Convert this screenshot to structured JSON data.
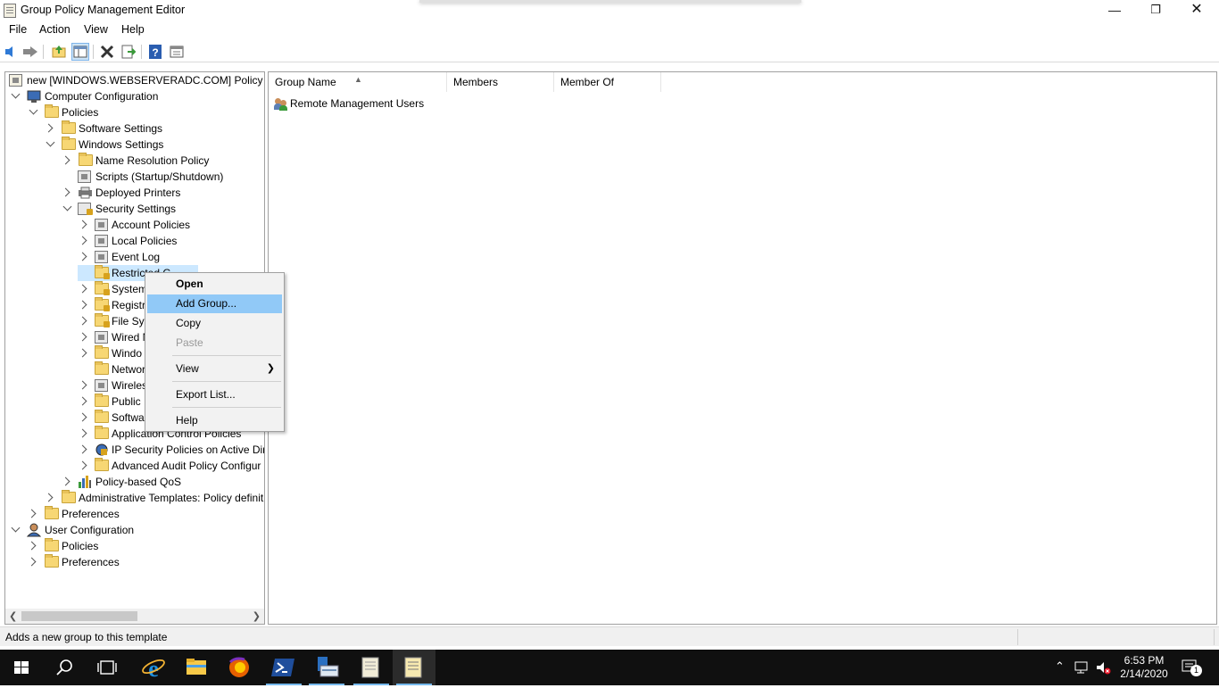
{
  "window": {
    "title": "Group Policy Management Editor"
  },
  "menu": {
    "file": "File",
    "action": "Action",
    "view": "View",
    "help": "Help"
  },
  "toolbar": {
    "buttons": [
      "back-icon",
      "forward-icon",
      "up-folder-icon",
      "show-hide-tree-icon",
      "delete-icon",
      "export-icon",
      "help-icon",
      "properties-icon"
    ]
  },
  "tree": {
    "root": "new [WINDOWS.WEBSERVERADC.COM] Policy",
    "computer_configuration": "Computer Configuration",
    "policies": "Policies",
    "software_settings": "Software Settings",
    "windows_settings": "Windows Settings",
    "name_resolution_policy": "Name Resolution Policy",
    "scripts": "Scripts (Startup/Shutdown)",
    "deployed_printers": "Deployed Printers",
    "security_settings": "Security Settings",
    "account_policies": "Account Policies",
    "local_policies": "Local Policies",
    "event_log": "Event Log",
    "restricted_groups": "Restricted G",
    "system_services": "System",
    "registry": "Registr",
    "file_system": "File Sys",
    "wired_network": "Wired N",
    "windows_firewall": "Windo",
    "network_list": "Networ",
    "wireless_network": "Wireles",
    "public_key": "Public",
    "software_restriction": "Softwa",
    "application_control": "Application Control Policies",
    "ip_security": "IP Security Policies on Active Dir",
    "advanced_audit": "Advanced Audit Policy Configur",
    "policy_qos": "Policy-based QoS",
    "admin_templates": "Administrative Templates: Policy definit",
    "preferences": "Preferences",
    "user_configuration": "User Configuration",
    "user_policies": "Policies",
    "user_preferences": "Preferences"
  },
  "list": {
    "columns": [
      "Group Name",
      "Members",
      "Member Of"
    ],
    "rows": [
      {
        "group_name": "Remote Management Users",
        "members": "",
        "member_of": ""
      }
    ]
  },
  "context_menu": {
    "open": "Open",
    "add_group": "Add Group...",
    "copy": "Copy",
    "paste": "Paste",
    "view": "View",
    "export_list": "Export List...",
    "help": "Help"
  },
  "status": {
    "message": "Adds a new group to this template"
  },
  "taskbar": {
    "time": "6:53 PM",
    "date": "2/14/2020",
    "notifications": "1",
    "apps": [
      "windows-start-icon",
      "search-icon",
      "task-view-icon",
      "internet-explorer-icon",
      "file-explorer-icon",
      "firefox-icon",
      "powershell-icon",
      "server-manager-icon",
      "notepad-icon",
      "group-policy-editor-icon"
    ]
  },
  "colors": {
    "menu_highlight": "#91c9f7",
    "taskbar": "#101010",
    "accent": "#76b9ed"
  }
}
